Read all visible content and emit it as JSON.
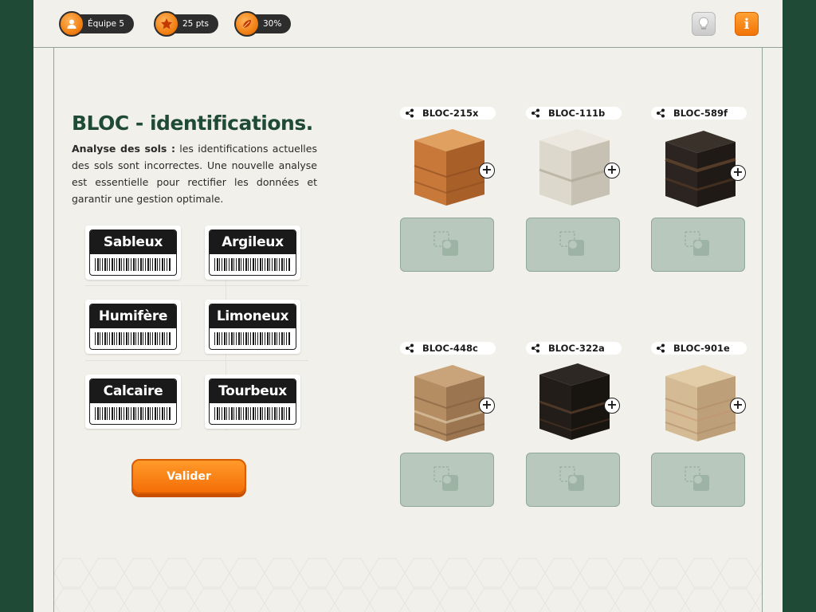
{
  "hud": {
    "team": "Équipe 5",
    "points": "25 pts",
    "progress": "30%",
    "progress_value": 30,
    "hint_icon": "lightbulb-icon",
    "info_label": "i"
  },
  "title": "BLOC - identifications.",
  "description": {
    "lead": "Analyse des sols :",
    "body": " les identifications actuelles des sols sont incorrectes. Une nouvelle analyse est essentielle pour rectifier les données et garantir une gestion optimale."
  },
  "labels": [
    "Sableux",
    "Argileux",
    "Humifère",
    "Limoneux",
    "Calcaire",
    "Tourbeux"
  ],
  "validate_label": "Valider",
  "blocks": [
    {
      "id": "BLOC-215x",
      "color": "#c8793a"
    },
    {
      "id": "BLOC-111b",
      "color": "#ddd8cc"
    },
    {
      "id": "BLOC-589f",
      "color": "#2b2420"
    },
    {
      "id": "BLOC-448c",
      "color": "#b58d62"
    },
    {
      "id": "BLOC-322a",
      "color": "#221d19"
    },
    {
      "id": "BLOC-901e",
      "color": "#d4bb96"
    }
  ],
  "colors": {
    "background": "#1f4a36",
    "paper": "#f1f0ea",
    "accent": "#f47a0c",
    "title": "#1f4a36",
    "slot": "#b9c8bd"
  }
}
